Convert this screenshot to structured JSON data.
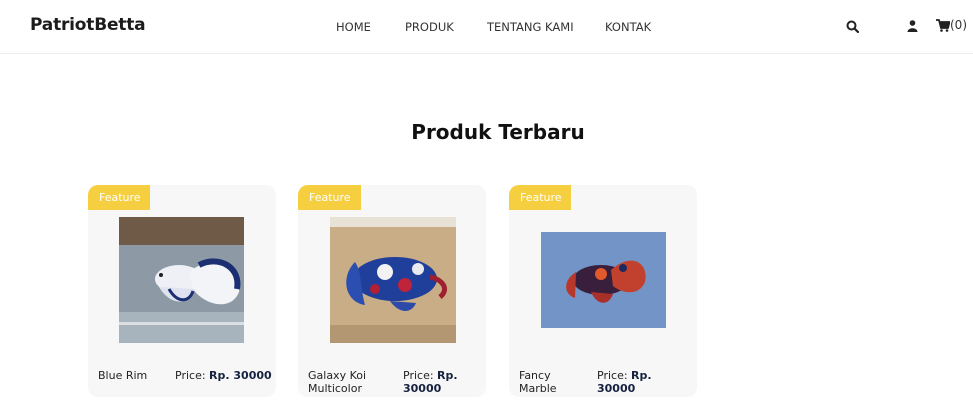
{
  "brand": "PatriotBetta",
  "nav": {
    "home": "HOME",
    "produk": "PRODUK",
    "tentang": "TENTANG KAMI",
    "kontak": "KONTAK"
  },
  "header_icons": [
    "search-icon",
    "user-icon",
    "cart-icon"
  ],
  "cart": {
    "count_label": "(0)"
  },
  "section": {
    "title": "Produk Terbaru"
  },
  "products": [
    {
      "badge": "Feature",
      "name": "Blue Rim",
      "price_label": "Price:",
      "price_value": "Rp. 30000"
    },
    {
      "badge": "Feature",
      "name": "Galaxy Koi Multicolor",
      "price_label": "Price:",
      "price_value": "Rp. 30000"
    },
    {
      "badge": "Feature",
      "name": "Fancy Marble",
      "price_label": "Price:",
      "price_value": "Rp. 30000"
    }
  ],
  "colors": {
    "badge": "#f5cf3f",
    "card_background": "#f7f7f7",
    "price_value": "#16213e"
  }
}
